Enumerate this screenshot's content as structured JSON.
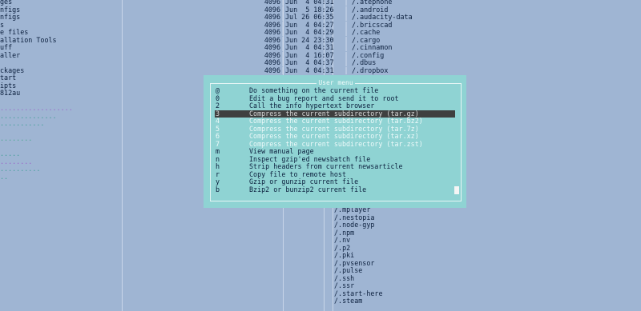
{
  "left_pane": [
    {
      "text": "ges"
    },
    {
      "text": "nfigs"
    },
    {
      "text": "nfigs"
    },
    {
      "text": "s"
    },
    {
      "text": "e files"
    },
    {
      "text": "allation Tools"
    },
    {
      "text": "uff"
    },
    {
      "text": "aller"
    },
    {
      "text": ""
    },
    {
      "text": "ckages"
    },
    {
      "text": "tart"
    },
    {
      "text": "ipts"
    },
    {
      "text": "812au"
    },
    {
      "text": ""
    },
    {
      "text": "..................",
      "color": "purple"
    },
    {
      "text": "..............",
      "color": "teal"
    },
    {
      "text": "...........",
      "color": "teal"
    },
    {
      "text": ""
    },
    {
      "text": "........",
      "color": "green"
    },
    {
      "text": ""
    },
    {
      "text": ".....",
      "color": "teal"
    },
    {
      "text": "........",
      "color": "purple"
    },
    {
      "text": "..........",
      "color": "teal"
    },
    {
      "text": "..",
      "color": "teal"
    }
  ],
  "files": [
    {
      "size": "4096",
      "date": "Jun  4 04:31",
      "name": "/.atephone"
    },
    {
      "size": "4096",
      "date": "Jun  5 18:26",
      "name": "/.android"
    },
    {
      "size": "4096",
      "date": "Jul 26 06:35",
      "name": "/.audacity-data"
    },
    {
      "size": "4096",
      "date": "Jun  4 04:27",
      "name": "/.bricscad"
    },
    {
      "size": "4096",
      "date": "Jun  4 04:29",
      "name": "/.cache"
    },
    {
      "size": "4096",
      "date": "Jun 24 23:30",
      "name": "/.cargo"
    },
    {
      "size": "4096",
      "date": "Jun  4 04:31",
      "name": "/.cinnamon"
    },
    {
      "size": "4096",
      "date": "Jun  4 16:07",
      "name": "/.config"
    },
    {
      "size": "4096",
      "date": "Jun  4 04:37",
      "name": "/.dbus"
    },
    {
      "size": "4096",
      "date": "Jun  4 04:31",
      "name": "/.dropbox"
    }
  ],
  "bottom_files": [
    "/.mplayer",
    "/.nestopia",
    "/.node-gyp",
    "/.npm",
    "/.nv",
    "/.p2",
    "/.pki",
    "/.pvsensor",
    "/.pulse",
    "/.ssh",
    "/.ssr",
    "/.start-here",
    "/.steam"
  ],
  "menu": {
    "title": "User menu",
    "items": [
      {
        "key": "@",
        "label": "Do something on the current file"
      },
      {
        "key": "0",
        "label": "Edit a bug report and send it to root"
      },
      {
        "key": "2",
        "label": "Call the info hypertext browser"
      },
      {
        "key": "3",
        "label": "Compress the current subdirectory (tar.gz)",
        "selected": true
      },
      {
        "key": "4",
        "label": "Compress the current subdirectory (tar.bz2)",
        "dim": true
      },
      {
        "key": "5",
        "label": "Compress the current subdirectory (tar.7z)",
        "dim": true
      },
      {
        "key": "6",
        "label": "Compress the current subdirectory (tar.xz)",
        "dim": true
      },
      {
        "key": "7",
        "label": "Compress the current subdirectory (tar.zst)",
        "dim": true
      },
      {
        "key": "m",
        "label": "View manual page"
      },
      {
        "key": "n",
        "label": "Inspect gzip'ed newsbatch file"
      },
      {
        "key": "h",
        "label": "Strip headers from current newsarticle"
      },
      {
        "key": "r",
        "label": "Copy file to remote host"
      },
      {
        "key": "y",
        "label": "Gzip or gunzip current file"
      },
      {
        "key": "b",
        "label": "Bzip2 or bunzip2 current file"
      }
    ]
  },
  "colors": {
    "background": "#9fb5d3",
    "menu_bg": "#8fd3d3",
    "selected_bg": "#3f3f3f"
  }
}
